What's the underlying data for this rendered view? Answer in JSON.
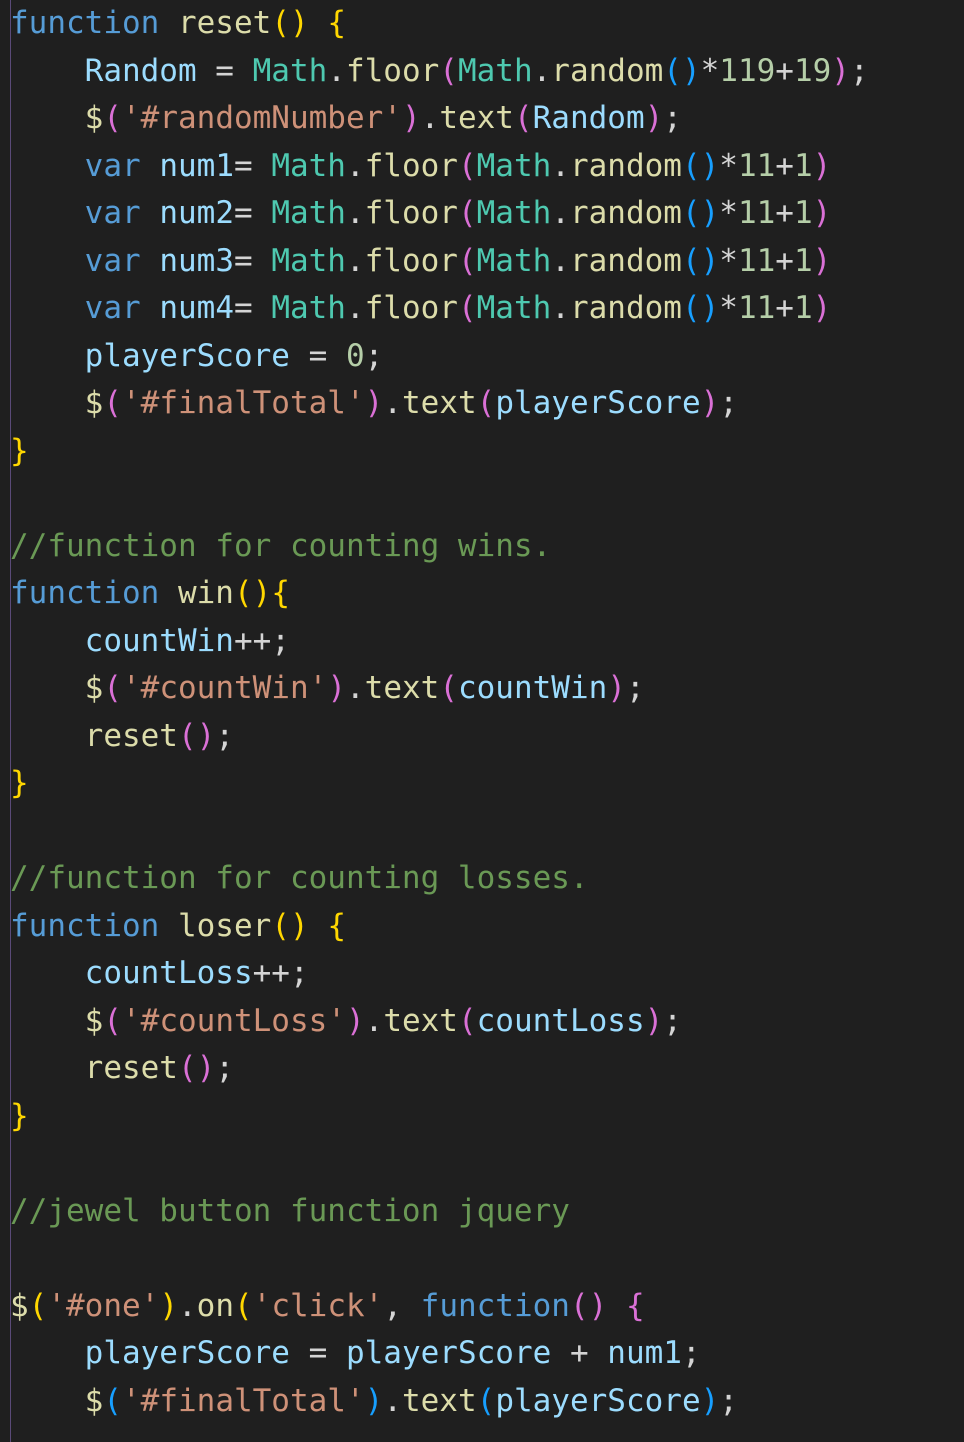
{
  "editor": {
    "colors": {
      "background": "#1f1f1f",
      "keyword": "#569cd6",
      "function": "#dcdcaa",
      "variable": "#9cdcfe",
      "class": "#4ec9b0",
      "string": "#ce9178",
      "number": "#b5cea8",
      "comment": "#6a9955",
      "text": "#d4d4d4",
      "bracket1": "#ffd700",
      "bracket2": "#da70d6",
      "bracket3": "#179fff"
    },
    "lines": [
      [
        [
          "kw",
          "function"
        ],
        [
          "op",
          " "
        ],
        [
          "fn",
          "reset"
        ],
        [
          "b1",
          "()"
        ],
        [
          "op",
          " "
        ],
        [
          "b1",
          "{"
        ]
      ],
      [
        [
          "op",
          "    "
        ],
        [
          "var",
          "Random"
        ],
        [
          "op",
          " = "
        ],
        [
          "cls",
          "Math"
        ],
        [
          "op",
          "."
        ],
        [
          "fn",
          "floor"
        ],
        [
          "b2",
          "("
        ],
        [
          "cls",
          "Math"
        ],
        [
          "op",
          "."
        ],
        [
          "fn",
          "random"
        ],
        [
          "b3",
          "()"
        ],
        [
          "op",
          "*"
        ],
        [
          "num",
          "119"
        ],
        [
          "op",
          "+"
        ],
        [
          "num",
          "19"
        ],
        [
          "b2",
          ")"
        ],
        [
          "op",
          ";"
        ]
      ],
      [
        [
          "op",
          "    "
        ],
        [
          "fn",
          "$"
        ],
        [
          "b2",
          "("
        ],
        [
          "str",
          "'#randomNumber'"
        ],
        [
          "b2",
          ")"
        ],
        [
          "op",
          "."
        ],
        [
          "fn",
          "text"
        ],
        [
          "b2",
          "("
        ],
        [
          "var",
          "Random"
        ],
        [
          "b2",
          ")"
        ],
        [
          "op",
          ";"
        ]
      ],
      [
        [
          "op",
          "    "
        ],
        [
          "kw",
          "var"
        ],
        [
          "op",
          " "
        ],
        [
          "var",
          "num1"
        ],
        [
          "op",
          "= "
        ],
        [
          "cls",
          "Math"
        ],
        [
          "op",
          "."
        ],
        [
          "fn",
          "floor"
        ],
        [
          "b2",
          "("
        ],
        [
          "cls",
          "Math"
        ],
        [
          "op",
          "."
        ],
        [
          "fn",
          "random"
        ],
        [
          "b3",
          "()"
        ],
        [
          "op",
          "*"
        ],
        [
          "num",
          "11"
        ],
        [
          "op",
          "+"
        ],
        [
          "num",
          "1"
        ],
        [
          "b2",
          ")"
        ]
      ],
      [
        [
          "op",
          "    "
        ],
        [
          "kw",
          "var"
        ],
        [
          "op",
          " "
        ],
        [
          "var",
          "num2"
        ],
        [
          "op",
          "= "
        ],
        [
          "cls",
          "Math"
        ],
        [
          "op",
          "."
        ],
        [
          "fn",
          "floor"
        ],
        [
          "b2",
          "("
        ],
        [
          "cls",
          "Math"
        ],
        [
          "op",
          "."
        ],
        [
          "fn",
          "random"
        ],
        [
          "b3",
          "()"
        ],
        [
          "op",
          "*"
        ],
        [
          "num",
          "11"
        ],
        [
          "op",
          "+"
        ],
        [
          "num",
          "1"
        ],
        [
          "b2",
          ")"
        ]
      ],
      [
        [
          "op",
          "    "
        ],
        [
          "kw",
          "var"
        ],
        [
          "op",
          " "
        ],
        [
          "var",
          "num3"
        ],
        [
          "op",
          "= "
        ],
        [
          "cls",
          "Math"
        ],
        [
          "op",
          "."
        ],
        [
          "fn",
          "floor"
        ],
        [
          "b2",
          "("
        ],
        [
          "cls",
          "Math"
        ],
        [
          "op",
          "."
        ],
        [
          "fn",
          "random"
        ],
        [
          "b3",
          "()"
        ],
        [
          "op",
          "*"
        ],
        [
          "num",
          "11"
        ],
        [
          "op",
          "+"
        ],
        [
          "num",
          "1"
        ],
        [
          "b2",
          ")"
        ]
      ],
      [
        [
          "op",
          "    "
        ],
        [
          "kw",
          "var"
        ],
        [
          "op",
          " "
        ],
        [
          "var",
          "num4"
        ],
        [
          "op",
          "= "
        ],
        [
          "cls",
          "Math"
        ],
        [
          "op",
          "."
        ],
        [
          "fn",
          "floor"
        ],
        [
          "b2",
          "("
        ],
        [
          "cls",
          "Math"
        ],
        [
          "op",
          "."
        ],
        [
          "fn",
          "random"
        ],
        [
          "b3",
          "()"
        ],
        [
          "op",
          "*"
        ],
        [
          "num",
          "11"
        ],
        [
          "op",
          "+"
        ],
        [
          "num",
          "1"
        ],
        [
          "b2",
          ")"
        ]
      ],
      [
        [
          "op",
          "    "
        ],
        [
          "var",
          "playerScore"
        ],
        [
          "op",
          " = "
        ],
        [
          "num",
          "0"
        ],
        [
          "op",
          ";"
        ]
      ],
      [
        [
          "op",
          "    "
        ],
        [
          "fn",
          "$"
        ],
        [
          "b2",
          "("
        ],
        [
          "str",
          "'#finalTotal'"
        ],
        [
          "b2",
          ")"
        ],
        [
          "op",
          "."
        ],
        [
          "fn",
          "text"
        ],
        [
          "b2",
          "("
        ],
        [
          "var",
          "playerScore"
        ],
        [
          "b2",
          ")"
        ],
        [
          "op",
          ";"
        ]
      ],
      [
        [
          "b1",
          "}"
        ]
      ],
      [],
      [
        [
          "com",
          "//function for counting wins."
        ]
      ],
      [
        [
          "kw",
          "function"
        ],
        [
          "op",
          " "
        ],
        [
          "fn",
          "win"
        ],
        [
          "b1",
          "()"
        ],
        [
          "b1",
          "{"
        ]
      ],
      [
        [
          "op",
          "    "
        ],
        [
          "var",
          "countWin"
        ],
        [
          "op",
          "++;"
        ]
      ],
      [
        [
          "op",
          "    "
        ],
        [
          "fn",
          "$"
        ],
        [
          "b2",
          "("
        ],
        [
          "str",
          "'#countWin'"
        ],
        [
          "b2",
          ")"
        ],
        [
          "op",
          "."
        ],
        [
          "fn",
          "text"
        ],
        [
          "b2",
          "("
        ],
        [
          "var",
          "countWin"
        ],
        [
          "b2",
          ")"
        ],
        [
          "op",
          ";"
        ]
      ],
      [
        [
          "op",
          "    "
        ],
        [
          "fn",
          "reset"
        ],
        [
          "b2",
          "()"
        ],
        [
          "op",
          ";"
        ]
      ],
      [
        [
          "b1",
          "}"
        ]
      ],
      [],
      [
        [
          "com",
          "//function for counting losses."
        ]
      ],
      [
        [
          "kw",
          "function"
        ],
        [
          "op",
          " "
        ],
        [
          "fn",
          "loser"
        ],
        [
          "b1",
          "()"
        ],
        [
          "op",
          " "
        ],
        [
          "b1",
          "{"
        ]
      ],
      [
        [
          "op",
          "    "
        ],
        [
          "var",
          "countLoss"
        ],
        [
          "op",
          "++;"
        ]
      ],
      [
        [
          "op",
          "    "
        ],
        [
          "fn",
          "$"
        ],
        [
          "b2",
          "("
        ],
        [
          "str",
          "'#countLoss'"
        ],
        [
          "b2",
          ")"
        ],
        [
          "op",
          "."
        ],
        [
          "fn",
          "text"
        ],
        [
          "b2",
          "("
        ],
        [
          "var",
          "countLoss"
        ],
        [
          "b2",
          ")"
        ],
        [
          "op",
          ";"
        ]
      ],
      [
        [
          "op",
          "    "
        ],
        [
          "fn",
          "reset"
        ],
        [
          "b2",
          "()"
        ],
        [
          "op",
          ";"
        ]
      ],
      [
        [
          "b1",
          "}"
        ]
      ],
      [],
      [
        [
          "com",
          "//jewel button function jquery"
        ]
      ],
      [],
      [
        [
          "fn",
          "$"
        ],
        [
          "b1",
          "("
        ],
        [
          "str",
          "'#one'"
        ],
        [
          "b1",
          ")"
        ],
        [
          "op",
          "."
        ],
        [
          "fn",
          "on"
        ],
        [
          "b1",
          "("
        ],
        [
          "str",
          "'click'"
        ],
        [
          "op",
          ", "
        ],
        [
          "kw",
          "function"
        ],
        [
          "b2",
          "()"
        ],
        [
          "op",
          " "
        ],
        [
          "b2",
          "{"
        ]
      ],
      [
        [
          "op",
          "    "
        ],
        [
          "var",
          "playerScore"
        ],
        [
          "op",
          " = "
        ],
        [
          "var",
          "playerScore"
        ],
        [
          "op",
          " + "
        ],
        [
          "var",
          "num1"
        ],
        [
          "op",
          ";"
        ]
      ],
      [
        [
          "op",
          "    "
        ],
        [
          "fn",
          "$"
        ],
        [
          "b3",
          "("
        ],
        [
          "str",
          "'#finalTotal'"
        ],
        [
          "b3",
          ")"
        ],
        [
          "op",
          "."
        ],
        [
          "fn",
          "text"
        ],
        [
          "b3",
          "("
        ],
        [
          "var",
          "playerScore"
        ],
        [
          "b3",
          ")"
        ],
        [
          "op",
          ";"
        ]
      ]
    ]
  }
}
